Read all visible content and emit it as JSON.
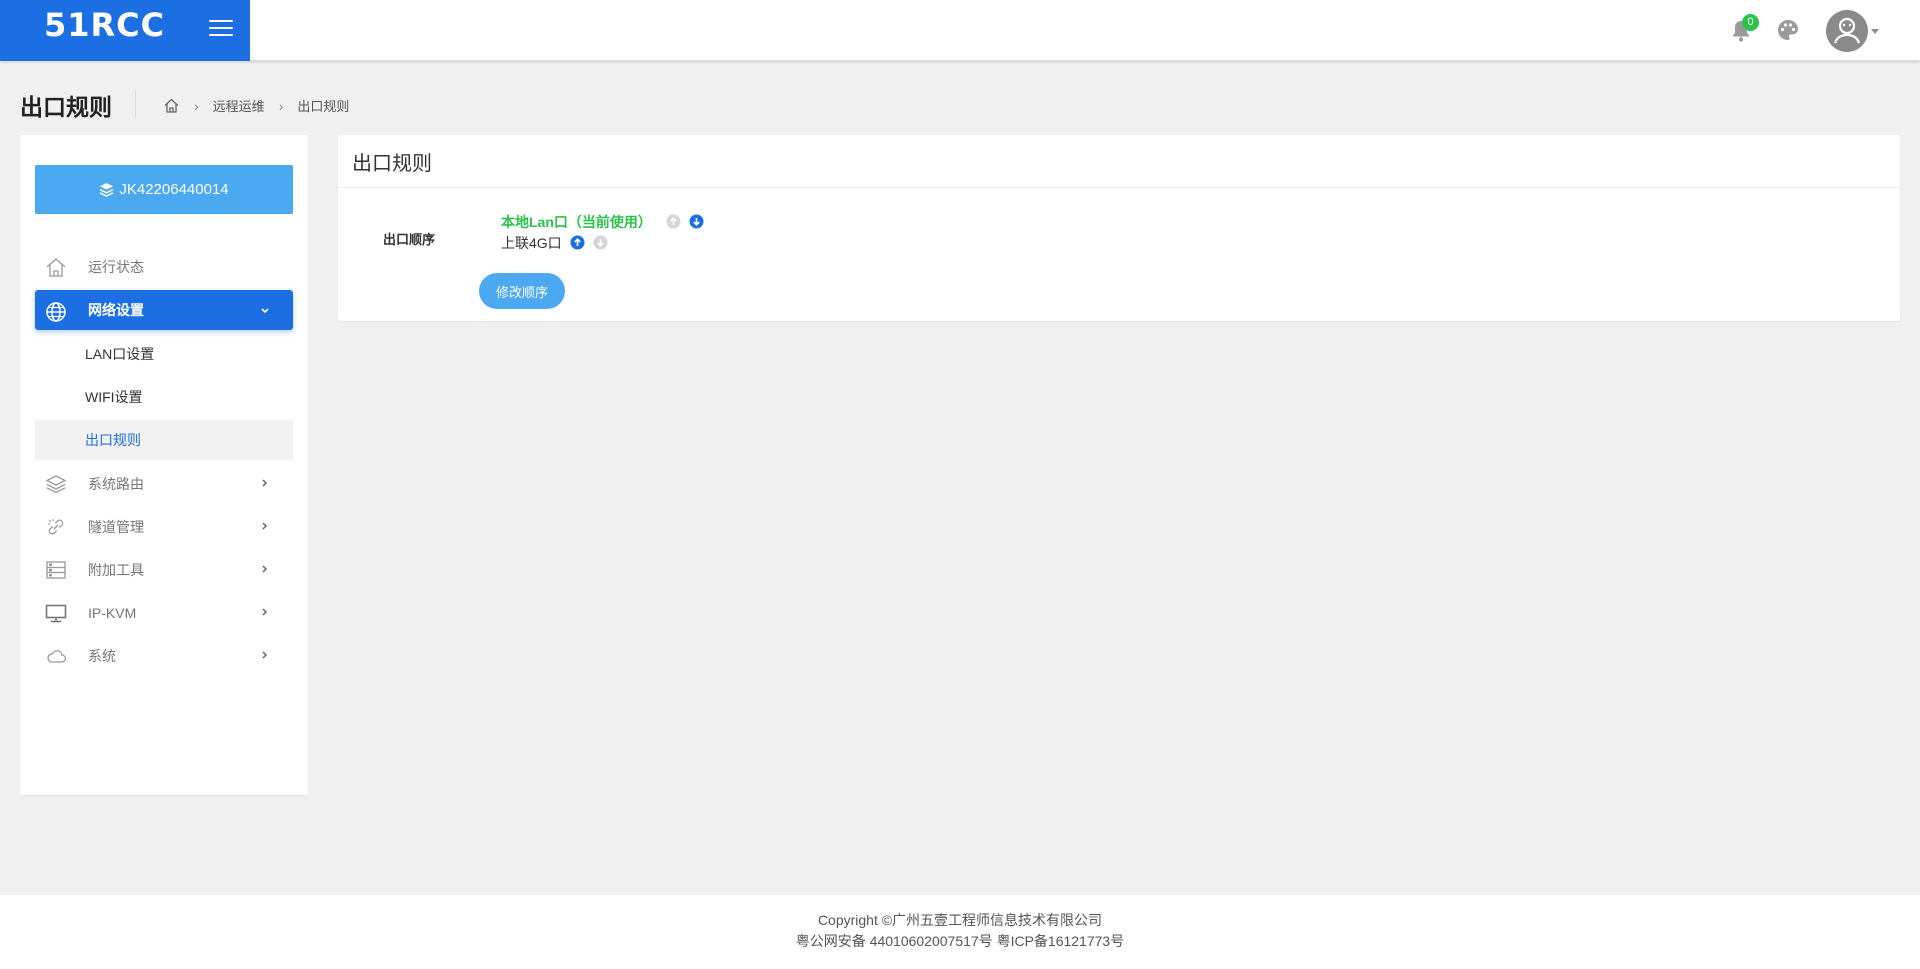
{
  "app": {
    "logo_text": "51RCC",
    "brand_color": "#1c6fe3",
    "notifications_count": "0"
  },
  "page": {
    "title": "出口规则",
    "breadcrumb": [
      "远程运维",
      "出口规则"
    ]
  },
  "sidebar": {
    "device_id": "JK42206440014",
    "menu": [
      {
        "label": "运行状态",
        "icon": "home-icon"
      },
      {
        "label": "网络设置",
        "icon": "globe-icon",
        "expanded": true,
        "children": [
          "LAN口设置",
          "WIFI设置",
          "出口规则"
        ],
        "selected_child": "出口规则"
      },
      {
        "label": "系统路由",
        "icon": "layers-icon"
      },
      {
        "label": "隧道管理",
        "icon": "link-icon"
      },
      {
        "label": "附加工具",
        "icon": "tools-icon"
      },
      {
        "label": "IP-KVM",
        "icon": "monitor-icon"
      },
      {
        "label": "系统",
        "icon": "cloud-icon"
      }
    ]
  },
  "card": {
    "title": "出口规则",
    "order_label": "出口顺序",
    "order_items": [
      {
        "name": "本地Lan口（当前使用）",
        "current": true
      },
      {
        "name": "上联4G口",
        "current": false
      }
    ],
    "modify_button": "修改顺序"
  },
  "footer": {
    "copyright": "Copyright ©广州五壹工程师信息技术有限公司",
    "icp": "粤公网安备 44010602007517号 粤ICP备16121773号"
  }
}
